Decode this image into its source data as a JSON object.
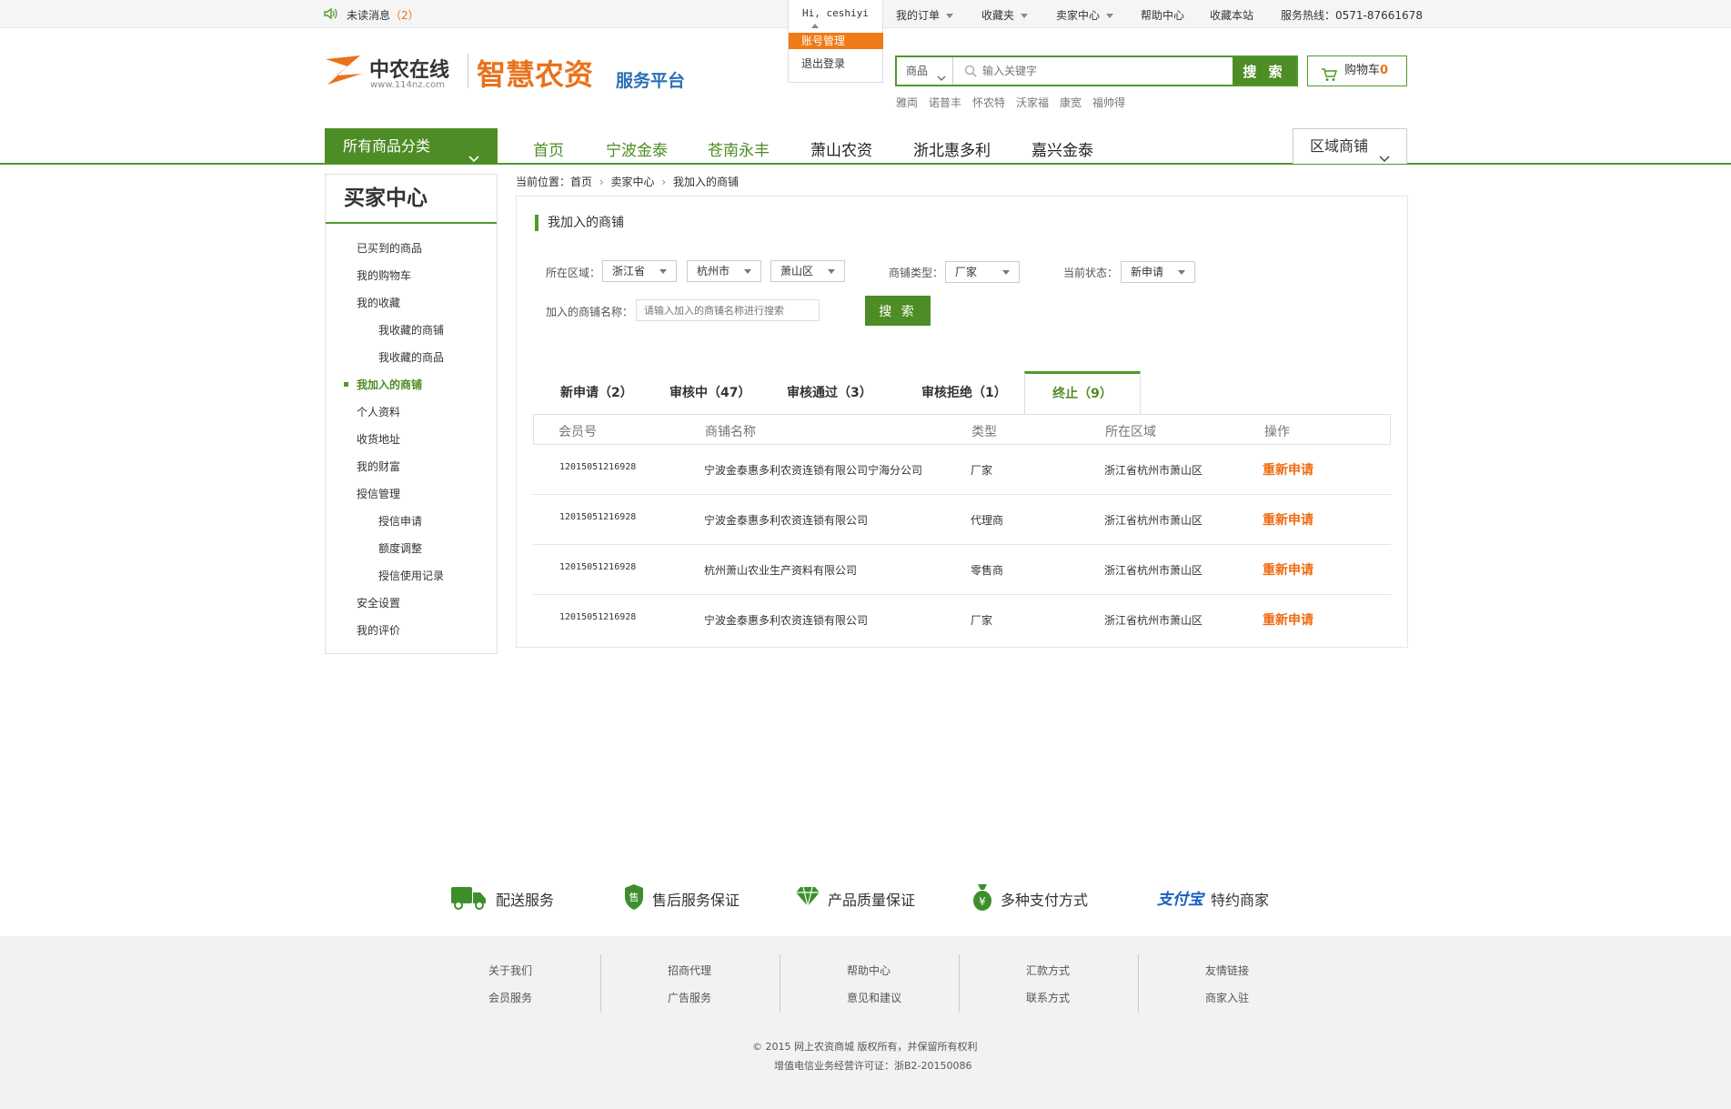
{
  "topbar": {
    "unread_label": "未读消息",
    "unread_count": "（2）",
    "user_greeting": "Hi, ceshiyi",
    "user_menu": [
      "账号管理",
      "退出登录"
    ],
    "my_orders": "我的订单",
    "favorites": "收藏夹",
    "seller_center": "卖家中心",
    "help_center": "帮助中心",
    "bookmark_site": "收藏本站",
    "hotline": "服务热线：0571-87661678"
  },
  "header": {
    "logo_name": "中农在线",
    "logo_url": "www.114nz.com",
    "platform_name": "智慧农资",
    "platform_suffix": "服务平台",
    "search_category": "商品",
    "search_placeholder": "输入关键字",
    "search_button": "搜 索",
    "cart_label": "购物车",
    "cart_count": "0",
    "hot_words": [
      "雅両",
      "诺普丰",
      "怀农特",
      "沃家福",
      "康宽",
      "福帅得"
    ]
  },
  "nav": {
    "all_categories": "所有商品分类",
    "items": [
      "首页",
      "宁波金泰",
      "苍南永丰",
      "萧山农资",
      "浙北惠多利",
      "嘉兴金泰"
    ],
    "region_shops": "区域商铺"
  },
  "sidebar": {
    "title": "买家中心",
    "items": [
      "已买到的商品",
      "我的购物车",
      "我的收藏",
      "我收藏的商铺",
      "我收藏的商品",
      "我加入的商铺",
      "个人资料",
      "收货地址",
      "我的财富",
      "授信管理",
      "授信申请",
      "额度调整",
      "授信使用记录",
      "安全设置",
      "我的评价"
    ]
  },
  "breadcrumb": {
    "prefix": "当前位置：",
    "items": [
      "首页",
      "卖家中心",
      "我加入的商铺"
    ]
  },
  "panel": {
    "title": "我加入的商铺",
    "filters": {
      "region_label": "所在区域：",
      "province": "浙江省",
      "city": "杭州市",
      "district": "萧山区",
      "shop_type_label": "商铺类型：",
      "shop_type": "厂家",
      "status_label": "当前状态：",
      "status": "新申请",
      "shop_name_label": "加入的商铺名称：",
      "shop_name_placeholder": "请输入加入的商铺名称进行搜索",
      "search_button": "搜 索"
    },
    "tabs": [
      "新申请（2）",
      "审核中（47）",
      "审核通过（3）",
      "审核拒绝（1）",
      "终止（9）"
    ],
    "table": {
      "headers": [
        "会员号",
        "商铺名称",
        "类型",
        "所在区域",
        "操作"
      ],
      "rows": [
        [
          "12015051216928",
          "宁波金泰惠多利农资连锁有限公司宁海分公司",
          "厂家",
          "浙江省杭州市萧山区",
          "重新申请"
        ],
        [
          "12015051216928",
          "宁波金泰惠多利农资连锁有限公司",
          "代理商",
          "浙江省杭州市萧山区",
          "重新申请"
        ],
        [
          "12015051216928",
          "杭州萧山农业生产资料有限公司",
          "零售商",
          "浙江省杭州市萧山区",
          "重新申请"
        ],
        [
          "12015051216928",
          "宁波金泰惠多利农资连锁有限公司",
          "厂家",
          "浙江省杭州市萧山区",
          "重新申请"
        ]
      ]
    }
  },
  "services": [
    "配送服务",
    "售后服务保证",
    "产品质量保证",
    "多种支付方式",
    "特约商家"
  ],
  "alipay_logo_text": "支付宝",
  "footer": {
    "columns": [
      [
        "关于我们",
        "会员服务"
      ],
      [
        "招商代理",
        "广告服务"
      ],
      [
        "帮助中心",
        "意见和建议"
      ],
      [
        "汇款方式",
        "联系方式"
      ],
      [
        "友情链接",
        "商家入驻"
      ]
    ],
    "copyright": "© 2015 网上农资商城 版权所有，并保留所有权利",
    "license": "增值电信业务经营许可证：浙B2-20150086"
  },
  "colors": {
    "brand_green": "#4e8c25",
    "accent_orange": "#f06a0f",
    "logo_orange": "#e8731c",
    "logo_blue": "#2a6fb8"
  }
}
